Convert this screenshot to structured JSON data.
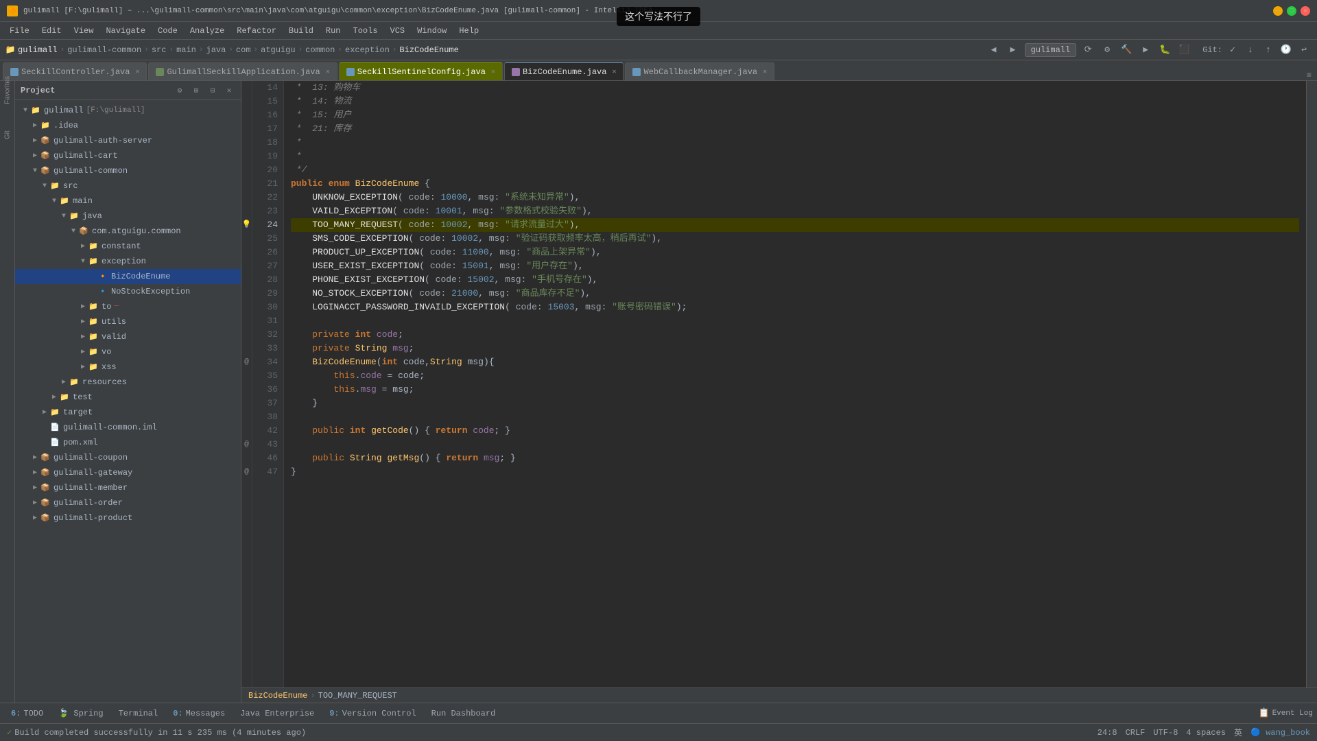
{
  "window": {
    "title": "gulimall [F:\\gulimall] – ...\\gulimall-common\\src\\main\\java\\com\\atguigu\\common\\exception\\BizCodeEnume.java [gulimall-common] - IntelliJ IDEA",
    "icon": "🔶"
  },
  "menubar": {
    "items": [
      "File",
      "Edit",
      "View",
      "Navigate",
      "Code",
      "Analyze",
      "Refactor",
      "Build",
      "Run",
      "Tools",
      "VCS",
      "Window",
      "Help"
    ]
  },
  "breadcrumb": {
    "items": [
      "gulimall",
      "gulimall-common",
      "src",
      "main",
      "java",
      "com",
      "atguigu",
      "common",
      "exception",
      "BizCodeEnume"
    ]
  },
  "project_selector": "gulimall",
  "tabs": [
    {
      "id": "seckill-ctrl",
      "label": "SeckillController.java",
      "icon": "ctrl",
      "active": false
    },
    {
      "id": "gulimall-app",
      "label": "GulimallSeckillApplication.java",
      "icon": "app",
      "active": false
    },
    {
      "id": "sentinel-cfg",
      "label": "SeckillSentinelConfig.java",
      "icon": "cfg",
      "active": false,
      "hover": true
    },
    {
      "id": "biz-enum",
      "label": "BizCodeEnume.java",
      "icon": "enum",
      "active": true
    },
    {
      "id": "webcallback",
      "label": "WebCallbackManager.java",
      "icon": "wcm",
      "active": false
    }
  ],
  "sidebar": {
    "title": "Project",
    "items": [
      {
        "id": "gulimall-root",
        "label": "gulimall",
        "level": 0,
        "type": "project",
        "expanded": true
      },
      {
        "id": "idea",
        "label": ".idea",
        "level": 1,
        "type": "folder",
        "expanded": false
      },
      {
        "id": "auth-server",
        "label": "gulimall-auth-server",
        "level": 1,
        "type": "module",
        "expanded": false
      },
      {
        "id": "cart",
        "label": "gulimall-cart",
        "level": 1,
        "type": "module",
        "expanded": false
      },
      {
        "id": "common",
        "label": "gulimall-common",
        "level": 1,
        "type": "module",
        "expanded": true
      },
      {
        "id": "src",
        "label": "src",
        "level": 2,
        "type": "folder",
        "expanded": true
      },
      {
        "id": "main",
        "label": "main",
        "level": 3,
        "type": "folder",
        "expanded": true
      },
      {
        "id": "java",
        "label": "java",
        "level": 4,
        "type": "folder",
        "expanded": true
      },
      {
        "id": "com.atguigu.common",
        "label": "com.atguigu.common",
        "level": 5,
        "type": "package",
        "expanded": true
      },
      {
        "id": "constant",
        "label": "constant",
        "level": 6,
        "type": "folder",
        "expanded": false
      },
      {
        "id": "exception",
        "label": "exception",
        "level": 6,
        "type": "folder",
        "expanded": true
      },
      {
        "id": "BizCodeEnume",
        "label": "BizCodeEnume",
        "level": 7,
        "type": "class",
        "selected": true
      },
      {
        "id": "NoStockException",
        "label": "NoStockException",
        "level": 7,
        "type": "class"
      },
      {
        "id": "to",
        "label": "to",
        "level": 6,
        "type": "folder",
        "expanded": false
      },
      {
        "id": "utils",
        "label": "utils",
        "level": 6,
        "type": "folder",
        "expanded": false
      },
      {
        "id": "valid",
        "label": "valid",
        "level": 6,
        "type": "folder",
        "expanded": false
      },
      {
        "id": "vo",
        "label": "vo",
        "level": 6,
        "type": "folder",
        "expanded": false
      },
      {
        "id": "xss",
        "label": "xss",
        "level": 6,
        "type": "folder",
        "expanded": false
      },
      {
        "id": "resources",
        "label": "resources",
        "level": 4,
        "type": "folder",
        "expanded": false
      },
      {
        "id": "test",
        "label": "test",
        "level": 3,
        "type": "folder",
        "expanded": false
      },
      {
        "id": "target",
        "label": "target",
        "level": 2,
        "type": "folder",
        "expanded": false
      },
      {
        "id": "iml",
        "label": "gulimall-common.iml",
        "level": 2,
        "type": "iml"
      },
      {
        "id": "pom",
        "label": "pom.xml",
        "level": 2,
        "type": "xml"
      },
      {
        "id": "coupon",
        "label": "gulimall-coupon",
        "level": 1,
        "type": "module",
        "expanded": false
      },
      {
        "id": "gateway",
        "label": "gulimall-gateway",
        "level": 1,
        "type": "module",
        "expanded": false
      },
      {
        "id": "member",
        "label": "gulimall-member",
        "level": 1,
        "type": "module",
        "expanded": false
      },
      {
        "id": "order",
        "label": "gulimall-order",
        "level": 1,
        "type": "module",
        "expanded": false
      },
      {
        "id": "product",
        "label": "gulimall-product",
        "level": 1,
        "type": "module",
        "expanded": false
      }
    ]
  },
  "editor": {
    "filename": "BizCodeEnume.java",
    "lines": [
      {
        "num": 14,
        "content": " *  13: 购物车",
        "type": "comment"
      },
      {
        "num": 15,
        "content": " *  14: 物流",
        "type": "comment"
      },
      {
        "num": 16,
        "content": " *  15: 用户",
        "type": "comment"
      },
      {
        "num": 17,
        "content": " *  21: 库存",
        "type": "comment"
      },
      {
        "num": 18,
        "content": " *",
        "type": "comment"
      },
      {
        "num": 19,
        "content": " *",
        "type": "comment"
      },
      {
        "num": 20,
        "content": " */",
        "type": "comment"
      },
      {
        "num": 21,
        "content": "public enum BizCodeEnume {",
        "type": "code"
      },
      {
        "num": 22,
        "content": "    UNKNOW_EXCEPTION( code: 10000, msg: \"系统未知异常\"),",
        "type": "code"
      },
      {
        "num": 23,
        "content": "    VAILD_EXCEPTION( code: 10001, msg: \"参数格式校验失败\"),",
        "type": "code"
      },
      {
        "num": 24,
        "content": "    TOO_MANY_REQUEST( code: 10002, msg: \"请求流量过大\"),",
        "type": "code",
        "highlighted": true
      },
      {
        "num": 25,
        "content": "    SMS_CODE_EXCEPTION( code: 10002, msg: \"验证码获取频率太高，稍后再试\"),",
        "type": "code"
      },
      {
        "num": 26,
        "content": "    PRODUCT_UP_EXCEPTION( code: 11000, msg: \"商品上架异常\"),",
        "type": "code"
      },
      {
        "num": 27,
        "content": "    USER_EXIST_EXCEPTION( code: 15001, msg: \"用户存在\"),",
        "type": "code"
      },
      {
        "num": 28,
        "content": "    PHONE_EXIST_EXCEPTION( code: 15002, msg: \"手机号存在\"),",
        "type": "code"
      },
      {
        "num": 29,
        "content": "    NO_STOCK_EXCEPTION( code: 21000, msg: \"商品库存不足\"),",
        "type": "code"
      },
      {
        "num": 30,
        "content": "    LOGINACCT_PASSWORD_INVAILD_EXCEPTION( code: 15003, msg: \"账号密码错误\");",
        "type": "code"
      },
      {
        "num": 31,
        "content": "",
        "type": "empty"
      },
      {
        "num": 32,
        "content": "    private int code;",
        "type": "code"
      },
      {
        "num": 33,
        "content": "    private String msg;",
        "type": "code"
      },
      {
        "num": 34,
        "content": "    BizCodeEnume(int code,String msg){",
        "type": "code",
        "annotation": true
      },
      {
        "num": 35,
        "content": "        this.code = code;",
        "type": "code"
      },
      {
        "num": 36,
        "content": "        this.msg = msg;",
        "type": "code"
      },
      {
        "num": 37,
        "content": "    }",
        "type": "code"
      },
      {
        "num": 38,
        "content": "",
        "type": "empty"
      },
      {
        "num": 42,
        "content": "    public int getCode() { return code; }",
        "type": "code",
        "annotation": true
      },
      {
        "num": 43,
        "content": "",
        "type": "empty"
      },
      {
        "num": 43,
        "content": "    public String getMsg() { return msg; }",
        "type": "code",
        "annotation": true
      },
      {
        "num": 46,
        "content": "}",
        "type": "code"
      },
      {
        "num": 47,
        "content": "",
        "type": "empty"
      }
    ]
  },
  "bottom_breadcrumb": {
    "items": [
      "BizCodeEnume",
      "TOO_MANY_REQUEST"
    ]
  },
  "bottom_tabs": [
    {
      "label": "TODO",
      "num": "6"
    },
    {
      "label": "Spring"
    },
    {
      "label": "Terminal"
    },
    {
      "label": "Messages",
      "num": "0"
    },
    {
      "label": "Java Enterprise"
    },
    {
      "label": "Version Control",
      "num": "9"
    },
    {
      "label": "Run Dashboard"
    }
  ],
  "status_bar": {
    "message": "Build completed successfully in 11 s 235 ms (4 minutes ago)",
    "position": "24:8",
    "line_ending": "CRLF",
    "encoding": "UTF-8",
    "indent": "4 spaces",
    "lang": "英",
    "user": "wang_book"
  },
  "floating_label": "这个写法不行了",
  "git": {
    "label": "Git:"
  }
}
